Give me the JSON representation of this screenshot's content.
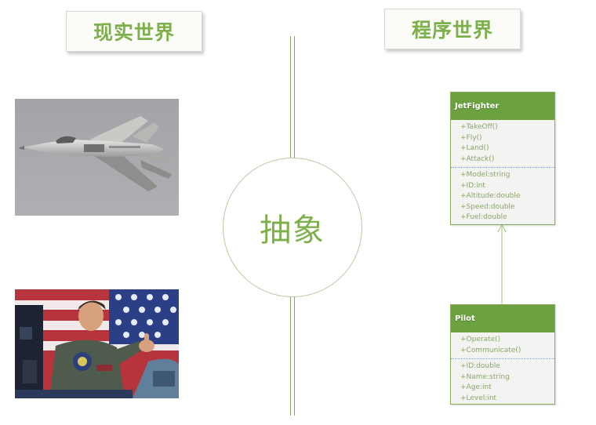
{
  "titles": {
    "real_world": "现实世界",
    "program_world": "程序世界"
  },
  "center": {
    "label": "抽象"
  },
  "classes": [
    {
      "name": "JetFighter",
      "methods": [
        "+TakeOff()",
        "+Fly()",
        "+Land()",
        "+Attack()"
      ],
      "attributes": [
        "+Model:string",
        "+ID:int",
        "+Altitude:double",
        "+Speed:double",
        "+Fuel:double"
      ]
    },
    {
      "name": "Pilot",
      "methods": [
        "+Operate()",
        "+Communicate()"
      ],
      "attributes": [
        "+ID:double",
        "+Name:string",
        "+Age:int",
        "+Level:int"
      ]
    }
  ],
  "colors": {
    "accent_green": "#7db04a",
    "uml_header": "#6ba13f",
    "uml_text": "#8aa66a"
  }
}
